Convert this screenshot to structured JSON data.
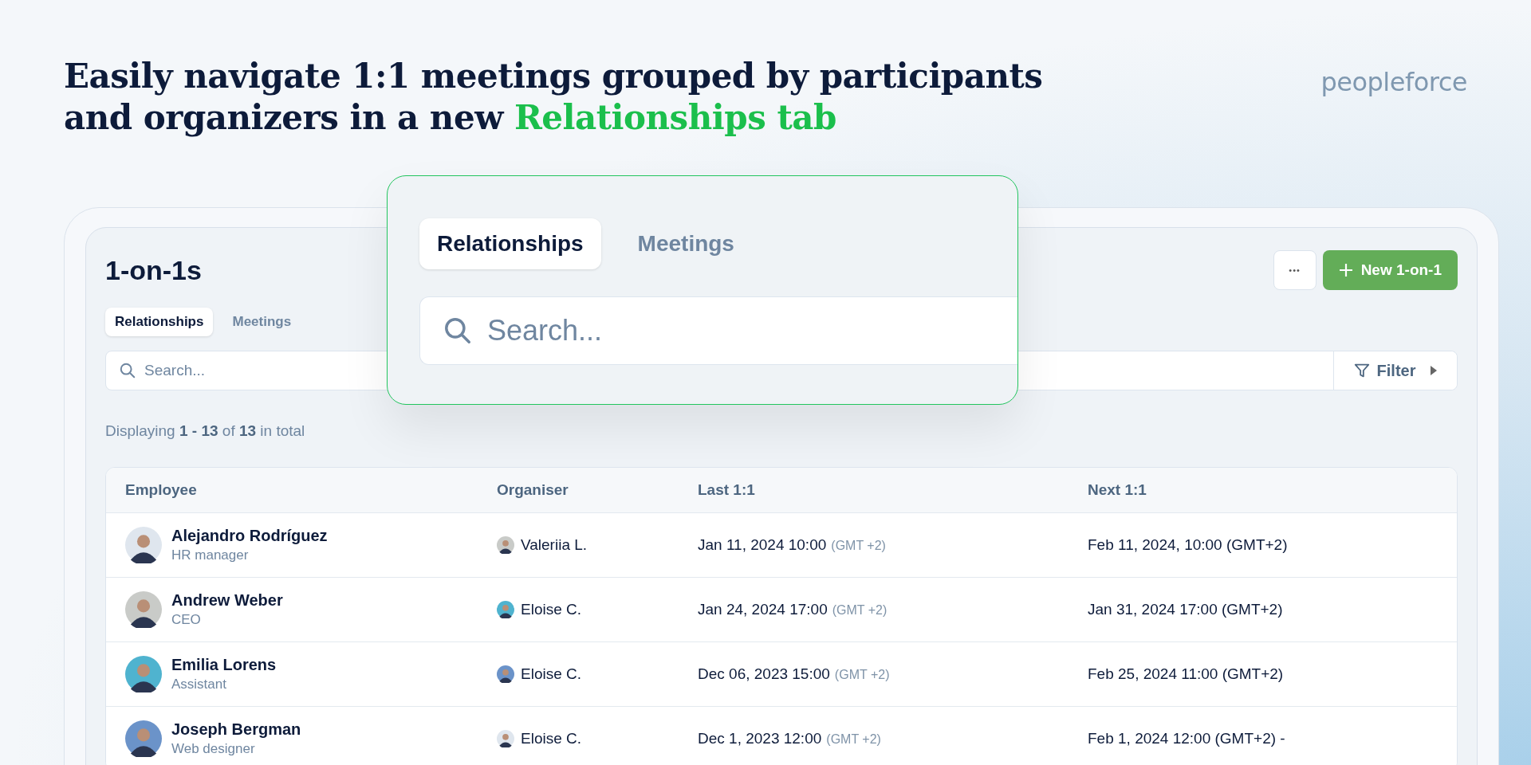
{
  "headline": {
    "text": "Easily navigate 1:1 meetings grouped by participants and organizers in a new",
    "highlight": "Relationships tab"
  },
  "logo": "peopleforce",
  "page": {
    "title": "1-on-1s",
    "more_button": "•••",
    "new_button": "New 1-on-1",
    "tabs": [
      {
        "label": "Relationships",
        "selected": true
      },
      {
        "label": "Meetings",
        "selected": false
      }
    ],
    "search": {
      "placeholder": "Search..."
    },
    "filter": "Filter",
    "summary": "Displaying **1 - 13** of **13** in total"
  },
  "table": {
    "columns": [
      "Employee",
      "Organiser",
      "Last 1:1",
      "Next 1:1"
    ],
    "rows": [
      {
        "name": "Alejandro Rodríguez",
        "role": "HR manager",
        "organiser": "Valeriia L.",
        "last_date": "Jan 11, 2024 10:00",
        "last_tz": "(GMT +2)",
        "next": "Feb 11, 2024, 10:00 (GMT+2)"
      },
      {
        "name": "Andrew Weber",
        "role": "CEO",
        "organiser": "Eloise C.",
        "last_date": "Jan 24, 2024 17:00",
        "last_tz": "(GMT +2)",
        "next": "Jan 31, 2024 17:00 (GMT+2)"
      },
      {
        "name": "Emilia Lorens",
        "role": "Assistant",
        "organiser": "Eloise C.",
        "last_date": "Dec 06, 2023 15:00",
        "last_tz": "(GMT +2)",
        "next": "Feb 25, 2024 11:00 (GMT+2)"
      },
      {
        "name": "Joseph Bergman",
        "role": "Web designer",
        "organiser": "Eloise C.",
        "last_date": "Dec 1, 2023 12:00",
        "last_tz": "(GMT +2)",
        "next": "Feb 1, 2024 12:00 (GMT+2) -"
      }
    ]
  },
  "zoom": {
    "tabs": [
      {
        "label": "Relationships",
        "selected": true
      },
      {
        "label": "Meetings",
        "selected": false
      }
    ],
    "search": {
      "placeholder": "Search..."
    }
  }
}
